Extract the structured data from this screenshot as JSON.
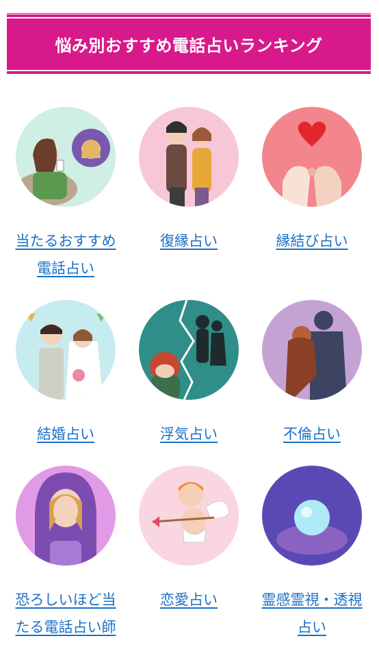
{
  "header": {
    "title": "悩み別おすすめ電話占いランキング"
  },
  "categories": [
    {
      "label": "当たるおすすめ電話占い",
      "icon": "woman-phone-reading-illustration"
    },
    {
      "label": "復縁占い",
      "icon": "couple-reunion-illustration"
    },
    {
      "label": "縁結び占い",
      "icon": "pinky-promise-heart-illustration"
    },
    {
      "label": "結婚占い",
      "icon": "wedding-couple-illustration"
    },
    {
      "label": "浮気占い",
      "icon": "cheating-silhouette-illustration"
    },
    {
      "label": "不倫占い",
      "icon": "affair-embrace-illustration"
    },
    {
      "label": "恐ろしいほど当たる電話占い師",
      "icon": "hooded-fortune-teller-illustration"
    },
    {
      "label": "恋愛占い",
      "icon": "cupid-arrow-illustration"
    },
    {
      "label": "霊感霊視・透視占い",
      "icon": "crystal-ball-illustration"
    }
  ],
  "colors": {
    "header_bg": "#d8198b",
    "link": "#1a6fc6"
  }
}
